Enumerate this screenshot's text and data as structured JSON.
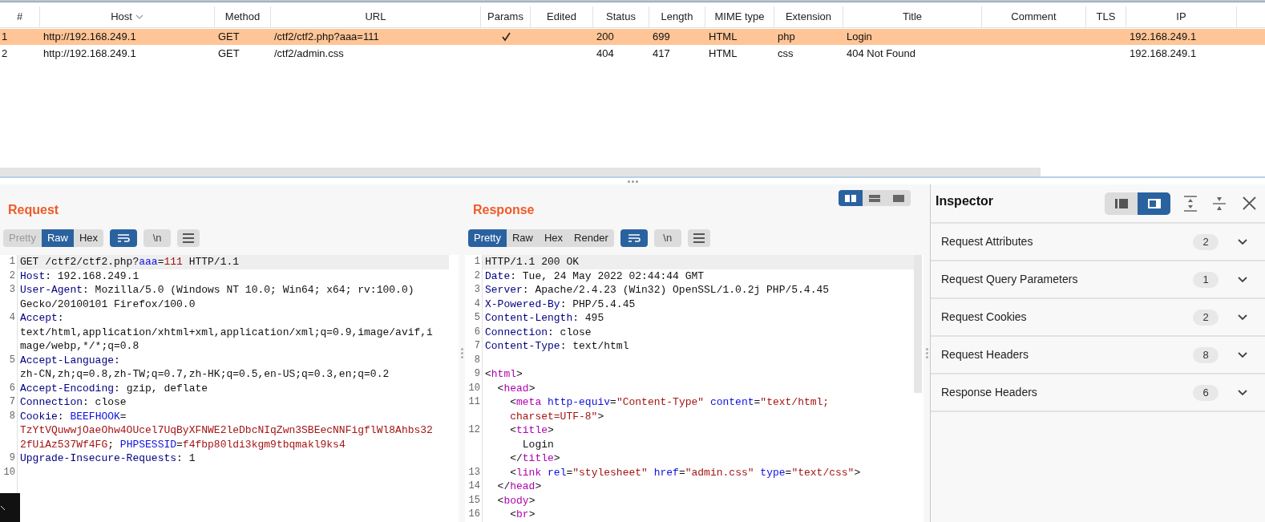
{
  "table": {
    "columns": [
      {
        "label": "#",
        "sorted": false
      },
      {
        "label": "Host",
        "sorted": true
      },
      {
        "label": "Method",
        "sorted": false
      },
      {
        "label": "URL",
        "sorted": false
      },
      {
        "label": "Params",
        "sorted": false
      },
      {
        "label": "Edited",
        "sorted": false
      },
      {
        "label": "Status",
        "sorted": false
      },
      {
        "label": "Length",
        "sorted": false
      },
      {
        "label": "MIME type",
        "sorted": false
      },
      {
        "label": "Extension",
        "sorted": false
      },
      {
        "label": "Title",
        "sorted": false
      },
      {
        "label": "Comment",
        "sorted": false
      },
      {
        "label": "TLS",
        "sorted": false
      },
      {
        "label": "IP",
        "sorted": false
      }
    ],
    "rows": [
      {
        "selected": true,
        "number": "1",
        "host": "http://192.168.249.1",
        "method": "GET",
        "url": "/ctf2/ctf2.php?aaa=111",
        "params": true,
        "status": "200",
        "length": "699",
        "mime_type": "HTML",
        "extension": "php",
        "title": "Login",
        "ip": "192.168.249.1"
      },
      {
        "selected": false,
        "number": "2",
        "host": "http://192.168.249.1",
        "method": "GET",
        "url": "/ctf2/admin.css",
        "params": false,
        "status": "404",
        "length": "417",
        "mime_type": "HTML",
        "extension": "css",
        "title": "404 Not Found",
        "ip": "192.168.249.1"
      }
    ]
  },
  "request": {
    "title": "Request",
    "view_tabs": [
      {
        "label": "Pretty",
        "selected": false,
        "disabled": true
      },
      {
        "label": "Raw",
        "selected": true,
        "disabled": false
      },
      {
        "label": "Hex",
        "selected": false,
        "disabled": false
      }
    ],
    "wrap_on": true,
    "newline_label": "\\n",
    "lines": [
      {
        "number": "1",
        "current": true,
        "visual_lines": [
          {
            "segments": [
              {
                "kind": "plain",
                "text": "GET /ctf2/ctf2.php?"
              },
              {
                "kind": "param",
                "text": "aaa"
              },
              {
                "kind": "plain",
                "text": "="
              },
              {
                "kind": "value",
                "text": "111"
              },
              {
                "kind": "plain",
                "text": " HTTP/1.1"
              }
            ]
          }
        ]
      },
      {
        "number": "2",
        "current": false,
        "visual_lines": [
          {
            "segments": [
              {
                "kind": "header",
                "text": "Host"
              },
              {
                "kind": "plain",
                "text": ": 192.168.249.1"
              }
            ]
          }
        ]
      },
      {
        "number": "3",
        "current": false,
        "visual_lines": [
          {
            "segments": [
              {
                "kind": "header",
                "text": "User-Agent"
              },
              {
                "kind": "plain",
                "text": ": Mozilla/5.0 (Windows NT 10.0; Win64; x64; rv:100.0)"
              }
            ]
          },
          {
            "segments": [
              {
                "kind": "plain",
                "text": "Gecko/20100101 Firefox/100.0"
              }
            ]
          }
        ]
      },
      {
        "number": "4",
        "current": false,
        "visual_lines": [
          {
            "segments": [
              {
                "kind": "header",
                "text": "Accept"
              },
              {
                "kind": "plain",
                "text": ":"
              }
            ]
          },
          {
            "segments": [
              {
                "kind": "plain",
                "text": "text/html,application/xhtml+xml,application/xml;q=0.9,image/avif,i"
              }
            ]
          },
          {
            "segments": [
              {
                "kind": "plain",
                "text": "mage/webp,*/*;q=0.8"
              }
            ]
          }
        ]
      },
      {
        "number": "5",
        "current": false,
        "visual_lines": [
          {
            "segments": [
              {
                "kind": "header",
                "text": "Accept-Language"
              },
              {
                "kind": "plain",
                "text": ":"
              }
            ]
          },
          {
            "segments": [
              {
                "kind": "plain",
                "text": "zh-CN,zh;q=0.8,zh-TW;q=0.7,zh-HK;q=0.5,en-US;q=0.3,en;q=0.2"
              }
            ]
          }
        ]
      },
      {
        "number": "6",
        "current": false,
        "visual_lines": [
          {
            "segments": [
              {
                "kind": "header",
                "text": "Accept-Encoding"
              },
              {
                "kind": "plain",
                "text": ": gzip, deflate"
              }
            ]
          }
        ]
      },
      {
        "number": "7",
        "current": false,
        "visual_lines": [
          {
            "segments": [
              {
                "kind": "header",
                "text": "Connection"
              },
              {
                "kind": "plain",
                "text": ": close"
              }
            ]
          }
        ]
      },
      {
        "number": "8",
        "current": false,
        "visual_lines": [
          {
            "segments": [
              {
                "kind": "header",
                "text": "Cookie"
              },
              {
                "kind": "plain",
                "text": ": "
              },
              {
                "kind": "param",
                "text": "BEEFHOOK"
              },
              {
                "kind": "plain",
                "text": "="
              }
            ]
          },
          {
            "segments": [
              {
                "kind": "value",
                "text": "TzYtVQuwwjOaeOhw4OUcel7UqByXFNWE2leDbcNIqZwn3SBEecNNFigflWl8Ahbs32"
              }
            ]
          },
          {
            "segments": [
              {
                "kind": "value",
                "text": "2fUiAz537Wf4FG"
              },
              {
                "kind": "plain",
                "text": "; "
              },
              {
                "kind": "param",
                "text": "PHPSESSID"
              },
              {
                "kind": "plain",
                "text": "="
              },
              {
                "kind": "value",
                "text": "f4fbp80ldi3kgm9tbqmakl9ks4"
              }
            ]
          }
        ]
      },
      {
        "number": "9",
        "current": false,
        "visual_lines": [
          {
            "segments": [
              {
                "kind": "header",
                "text": "Upgrade-Insecure-Requests"
              },
              {
                "kind": "plain",
                "text": ": 1"
              }
            ]
          }
        ]
      },
      {
        "number": "10",
        "current": false
      }
    ]
  },
  "response": {
    "title": "Response",
    "layout_buttons": [
      {
        "kind": "columns",
        "selected": true
      },
      {
        "kind": "rows",
        "selected": false
      },
      {
        "kind": "single",
        "selected": false
      }
    ],
    "view_tabs": [
      {
        "label": "Pretty",
        "selected": true,
        "disabled": false
      },
      {
        "label": "Raw",
        "selected": false,
        "disabled": false
      },
      {
        "label": "Hex",
        "selected": false,
        "disabled": false
      },
      {
        "label": "Render",
        "selected": false,
        "disabled": false
      }
    ],
    "wrap_on": true,
    "newline_label": "\\n",
    "lines": [
      {
        "number": "1",
        "current": true,
        "visual_lines": [
          {
            "segments": [
              {
                "kind": "plain",
                "text": "HTTP/1.1 200 OK"
              }
            ]
          }
        ]
      },
      {
        "number": "2",
        "current": false,
        "visual_lines": [
          {
            "segments": [
              {
                "kind": "header",
                "text": "Date"
              },
              {
                "kind": "plain",
                "text": ": Tue, 24 May 2022 02:44:44 GMT"
              }
            ]
          }
        ]
      },
      {
        "number": "3",
        "current": false,
        "visual_lines": [
          {
            "segments": [
              {
                "kind": "header",
                "text": "Server"
              },
              {
                "kind": "plain",
                "text": ": Apache/2.4.23 (Win32) OpenSSL/1.0.2j PHP/5.4.45"
              }
            ]
          }
        ]
      },
      {
        "number": "4",
        "current": false,
        "visual_lines": [
          {
            "segments": [
              {
                "kind": "header",
                "text": "X-Powered-By"
              },
              {
                "kind": "plain",
                "text": ": PHP/5.4.45"
              }
            ]
          }
        ]
      },
      {
        "number": "5",
        "current": false,
        "visual_lines": [
          {
            "segments": [
              {
                "kind": "header",
                "text": "Content-Length"
              },
              {
                "kind": "plain",
                "text": ": 495"
              }
            ]
          }
        ]
      },
      {
        "number": "6",
        "current": false,
        "visual_lines": [
          {
            "segments": [
              {
                "kind": "header",
                "text": "Connection"
              },
              {
                "kind": "plain",
                "text": ": close"
              }
            ]
          }
        ]
      },
      {
        "number": "7",
        "current": false,
        "visual_lines": [
          {
            "segments": [
              {
                "kind": "header",
                "text": "Content-Type"
              },
              {
                "kind": "plain",
                "text": ": text/html"
              }
            ]
          }
        ]
      },
      {
        "number": "8",
        "current": false
      },
      {
        "number": "9",
        "current": false,
        "visual_lines": [
          {
            "segments": [
              {
                "kind": "plain",
                "text": "<"
              },
              {
                "kind": "tag",
                "text": "html"
              },
              {
                "kind": "plain",
                "text": ">"
              }
            ]
          }
        ]
      },
      {
        "number": "10",
        "current": false,
        "visual_lines": [
          {
            "segments": [
              {
                "kind": "plain",
                "text": "  <"
              },
              {
                "kind": "tag",
                "text": "head"
              },
              {
                "kind": "plain",
                "text": ">"
              }
            ]
          }
        ]
      },
      {
        "number": "11",
        "current": false,
        "visual_lines": [
          {
            "segments": [
              {
                "kind": "plain",
                "text": "    <"
              },
              {
                "kind": "tag",
                "text": "meta"
              },
              {
                "kind": "attr",
                "text": " http-equiv"
              },
              {
                "kind": "plain",
                "text": "="
              },
              {
                "kind": "string",
                "text": "\"Content-Type\""
              },
              {
                "kind": "attr",
                "text": " content"
              },
              {
                "kind": "plain",
                "text": "="
              },
              {
                "kind": "string",
                "text": "\"text/html;"
              }
            ]
          },
          {
            "segments": [
              {
                "kind": "string",
                "text": "    charset=UTF-8\""
              },
              {
                "kind": "plain",
                "text": ">"
              }
            ]
          }
        ]
      },
      {
        "number": "12",
        "current": false,
        "visual_lines": [
          {
            "segments": [
              {
                "kind": "plain",
                "text": "    <"
              },
              {
                "kind": "tag",
                "text": "title"
              },
              {
                "kind": "plain",
                "text": ">"
              }
            ]
          },
          {
            "segments": [
              {
                "kind": "plain",
                "text": "      Login"
              }
            ]
          },
          {
            "segments": [
              {
                "kind": "plain",
                "text": "    </"
              },
              {
                "kind": "tag",
                "text": "title"
              },
              {
                "kind": "plain",
                "text": ">"
              }
            ]
          }
        ]
      },
      {
        "number": "13",
        "current": false,
        "visual_lines": [
          {
            "segments": [
              {
                "kind": "plain",
                "text": "    <"
              },
              {
                "kind": "tag",
                "text": "link"
              },
              {
                "kind": "attr",
                "text": " rel"
              },
              {
                "kind": "plain",
                "text": "="
              },
              {
                "kind": "string",
                "text": "\"stylesheet\""
              },
              {
                "kind": "attr",
                "text": " href"
              },
              {
                "kind": "plain",
                "text": "="
              },
              {
                "kind": "string",
                "text": "\"admin.css\""
              },
              {
                "kind": "attr",
                "text": " type"
              },
              {
                "kind": "plain",
                "text": "="
              },
              {
                "kind": "string",
                "text": "\"text/css\""
              },
              {
                "kind": "plain",
                "text": ">"
              }
            ]
          }
        ]
      },
      {
        "number": "14",
        "current": false,
        "visual_lines": [
          {
            "segments": [
              {
                "kind": "plain",
                "text": "  </"
              },
              {
                "kind": "tag",
                "text": "head"
              },
              {
                "kind": "plain",
                "text": ">"
              }
            ]
          }
        ]
      },
      {
        "number": "15",
        "current": false,
        "visual_lines": [
          {
            "segments": [
              {
                "kind": "plain",
                "text": "  <"
              },
              {
                "kind": "tag",
                "text": "body"
              },
              {
                "kind": "plain",
                "text": ">"
              }
            ]
          }
        ]
      },
      {
        "number": "16",
        "current": false,
        "visual_lines": [
          {
            "segments": [
              {
                "kind": "plain",
                "text": "    <"
              },
              {
                "kind": "tag",
                "text": "br"
              },
              {
                "kind": "plain",
                "text": ">"
              }
            ]
          }
        ]
      }
    ]
  },
  "inspector": {
    "title": "Inspector",
    "layout_buttons": [
      {
        "kind": "sidebar",
        "selected": false
      },
      {
        "kind": "panel",
        "selected": true
      }
    ],
    "sections": [
      {
        "label": "Request Attributes",
        "count": "2",
        "expanded": false
      },
      {
        "label": "Request Query Parameters",
        "count": "1",
        "expanded": false
      },
      {
        "label": "Request Cookies",
        "count": "2",
        "expanded": false
      },
      {
        "label": "Request Headers",
        "count": "8",
        "expanded": false
      },
      {
        "label": "Response Headers",
        "count": "6",
        "expanded": false
      }
    ]
  }
}
